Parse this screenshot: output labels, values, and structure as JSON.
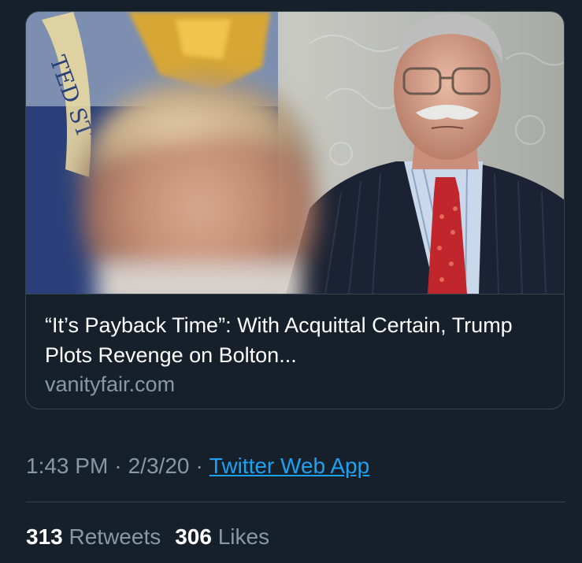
{
  "link_card": {
    "image_alt": "Photo for Vanity Fair article",
    "title": "“It’s Payback Time”: With Acquittal Certain, Trump Plots Revenge on Bolton...",
    "domain": "vanityfair.com"
  },
  "tweet_meta": {
    "time": "1:43 PM",
    "date": "2/3/20",
    "separator": "·",
    "source": "Twitter Web App"
  },
  "stats": {
    "retweets_count": "313",
    "retweets_label": "Retweets",
    "likes_count": "306",
    "likes_label": "Likes"
  },
  "colors": {
    "background": "#15202b",
    "border": "#38444d",
    "primary_text": "#ffffff",
    "secondary_text": "#8899a6",
    "link": "#1da1f2"
  }
}
